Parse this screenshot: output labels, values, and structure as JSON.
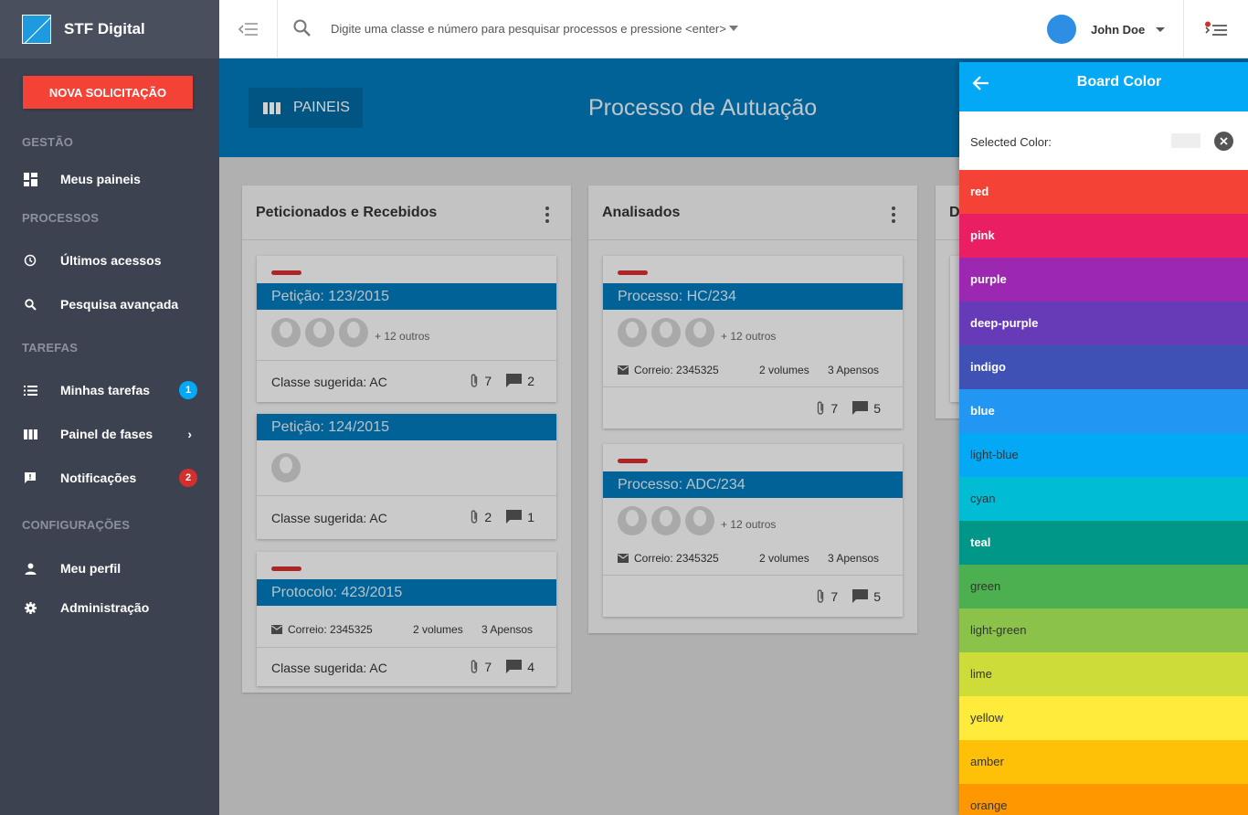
{
  "brand": {
    "name": "STF Digital"
  },
  "sidebar": {
    "new_button": "NOVA SOLICITAÇÃO",
    "sections": {
      "gestao": "GESTÃO",
      "processos": "PROCESSOS",
      "tarefas": "TAREFAS",
      "configuracoes": "CONFIGURAÇÕES"
    },
    "items": {
      "meus_paineis": "Meus paineis",
      "ultimos_acessos": "Últimos acessos",
      "pesquisa_avancada": "Pesquisa avançada",
      "minhas_tarefas": "Minhas tarefas",
      "minhas_tarefas_badge": "1",
      "painel_fases": "Painel de fases",
      "notificacoes": "Notificações",
      "notificacoes_badge": "2",
      "meu_perfil": "Meu perfil",
      "administracao": "Administração"
    },
    "colors": {
      "background": "#3d4250",
      "badge_blue": "#03a9f4",
      "badge_red": "#d32f2f",
      "new_button": "#f44336"
    }
  },
  "topbar": {
    "search_placeholder": "Digite uma classe e número para pesquisar processos e pressione <enter>",
    "user_name": "John Doe"
  },
  "header": {
    "paineis_label": "PAINEIS",
    "title": "Processo de Autuação"
  },
  "columns": [
    {
      "title": "Peticionados e Recebidos",
      "cards": [
        {
          "title": "Petição: 123/2015",
          "others": "+ 12 outros",
          "classe": "Classe sugerida: AC",
          "attachments": "7",
          "comments": "2"
        },
        {
          "title": "Petição: 124/2015",
          "classe": "Classe sugerida: AC",
          "attachments": "2",
          "comments": "1"
        },
        {
          "title": "Protocolo: 423/2015",
          "correio": "Correio: 2345325",
          "volumes": "2 volumes",
          "apensos": "3 Apensos",
          "classe": "Classe sugerida: AC",
          "attachments": "7",
          "comments": "4"
        }
      ]
    },
    {
      "title": "Analisados",
      "cards": [
        {
          "title": "Processo: HC/234",
          "others": "+ 12 outros",
          "correio": "Correio: 2345325",
          "volumes": "2 volumes",
          "apensos": "3 Apensos",
          "attachments": "7",
          "comments": "5"
        },
        {
          "title": "Processo: ADC/234",
          "others": "+ 12 outros",
          "correio": "Correio: 2345325",
          "volumes": "2 volumes",
          "apensos": "3 Apensos",
          "attachments": "7",
          "comments": "5"
        }
      ]
    },
    {
      "title": "D"
    }
  ],
  "panel": {
    "title": "Board Color",
    "selected_label": "Selected Color:",
    "colors": [
      {
        "name": "red",
        "hex": "#f44336",
        "text": "#ffffff",
        "bold": true
      },
      {
        "name": "pink",
        "hex": "#e91e63",
        "text": "#ffffff",
        "bold": true
      },
      {
        "name": "purple",
        "hex": "#9c27b0",
        "text": "#ffffff",
        "bold": true
      },
      {
        "name": "deep-purple",
        "hex": "#673ab7",
        "text": "#ffffff",
        "bold": true
      },
      {
        "name": "indigo",
        "hex": "#3f51b5",
        "text": "#ffffff",
        "bold": true
      },
      {
        "name": "blue",
        "hex": "#2196f3",
        "text": "#ffffff",
        "bold": true
      },
      {
        "name": "light-blue",
        "hex": "#03a9f4",
        "text": "#333333",
        "bold": false
      },
      {
        "name": "cyan",
        "hex": "#00bcd4",
        "text": "#333333",
        "bold": false
      },
      {
        "name": "teal",
        "hex": "#009688",
        "text": "#ffffff",
        "bold": true
      },
      {
        "name": "green",
        "hex": "#4caf50",
        "text": "#333333",
        "bold": false
      },
      {
        "name": "light-green",
        "hex": "#8bc34a",
        "text": "#333333",
        "bold": false
      },
      {
        "name": "lime",
        "hex": "#cddc39",
        "text": "#333333",
        "bold": false
      },
      {
        "name": "yellow",
        "hex": "#ffeb3b",
        "text": "#333333",
        "bold": false
      },
      {
        "name": "amber",
        "hex": "#ffc107",
        "text": "#333333",
        "bold": false
      },
      {
        "name": "orange",
        "hex": "#ff9800",
        "text": "#333333",
        "bold": false
      }
    ]
  },
  "icons": [
    "menu-collapse-icon",
    "search-icon",
    "notifications-list-icon",
    "dashboard-icon",
    "history-icon",
    "list-icon",
    "columns-icon",
    "feedback-icon",
    "person-icon",
    "gear-icon",
    "attachment-icon",
    "comment-icon",
    "mail-icon",
    "back-arrow-icon",
    "clear-icon",
    "kebab-icon"
  ]
}
